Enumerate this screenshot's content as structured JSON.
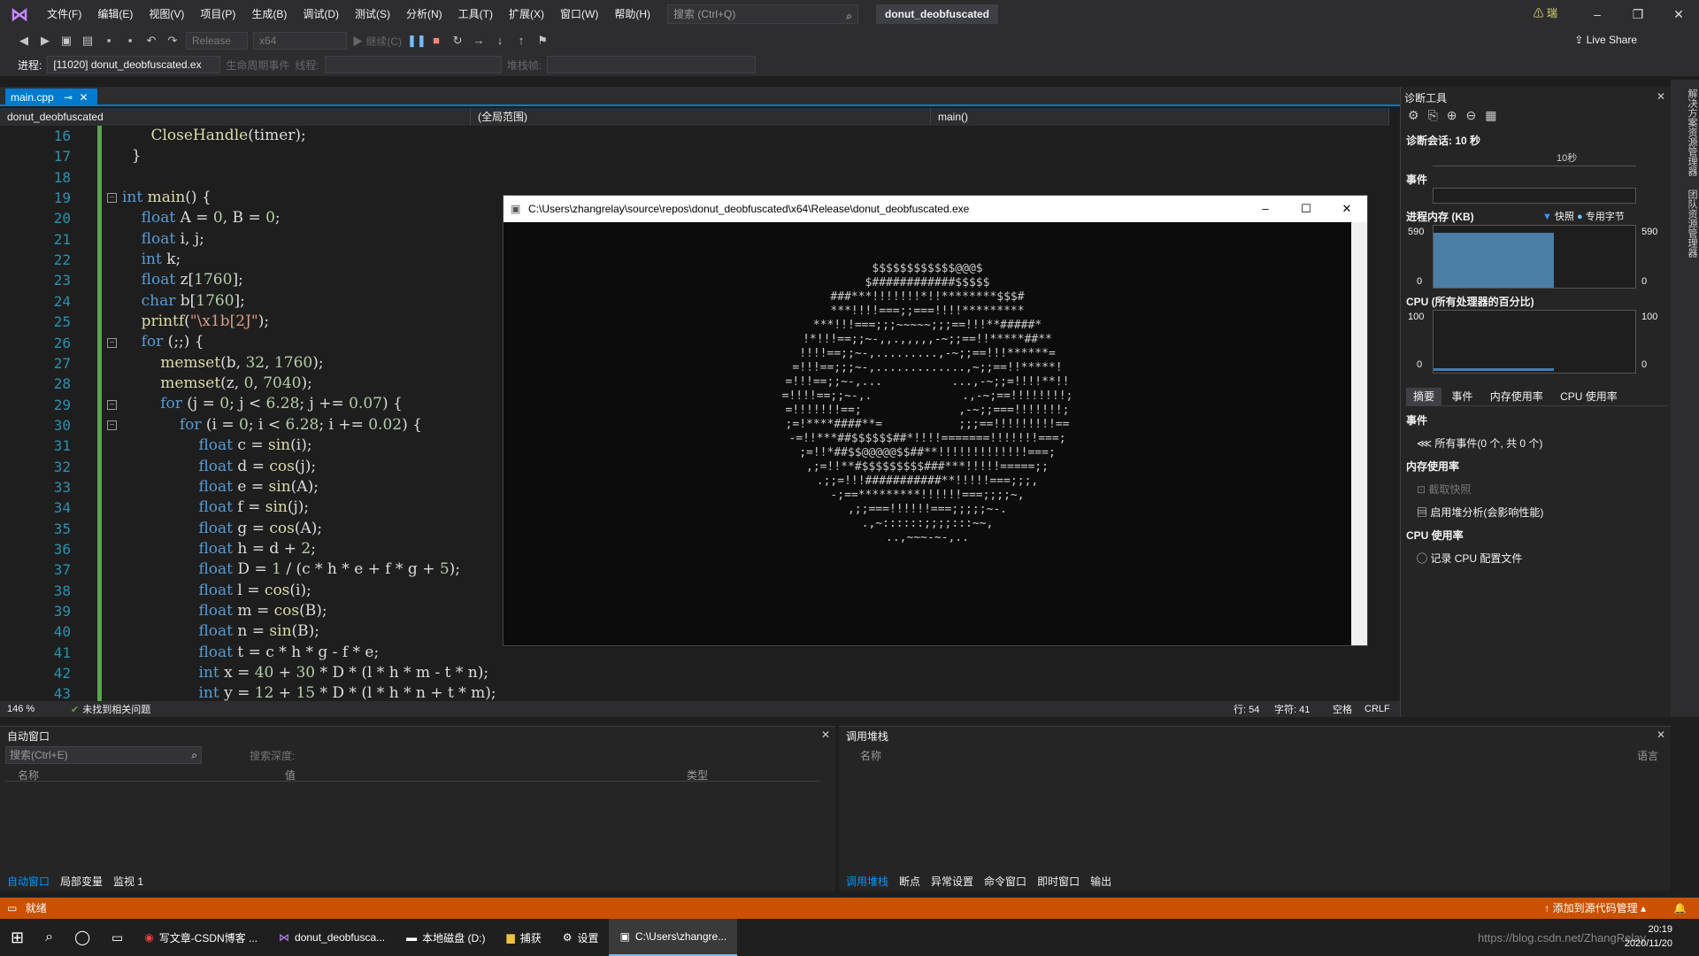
{
  "menubar": {
    "items": [
      "文件(F)",
      "编辑(E)",
      "视图(V)",
      "项目(P)",
      "生成(B)",
      "调试(D)",
      "测试(S)",
      "分析(N)",
      "工具(T)",
      "扩展(X)",
      "窗口(W)",
      "帮助(H)"
    ],
    "search_placeholder": "搜索 (Ctrl+Q)",
    "solution_name": "donut_deobfuscated",
    "user": "瑞"
  },
  "toolbar": {
    "config": "Release",
    "platform": "x64",
    "continue_label": "继续(C)",
    "live_share": "Live Share",
    "process_label": "进程:",
    "process_value": "[11020] donut_deobfuscated.ex",
    "lifecycle_label": "生命周期事件",
    "thread_label": "线程:",
    "stackframe_label": "堆栈帧:"
  },
  "editor": {
    "tab_label": "main.cpp",
    "nav_project": "donut_deobfuscated",
    "nav_scope": "(全局范围)",
    "nav_function": "main()",
    "line_numbers": [
      "16",
      "17",
      "18",
      "19",
      "20",
      "21",
      "22",
      "23",
      "24",
      "25",
      "26",
      "27",
      "28",
      "29",
      "30",
      "31",
      "32",
      "33",
      "34",
      "35",
      "36",
      "37",
      "38",
      "39",
      "40",
      "41",
      "42",
      "43"
    ],
    "zoom": "146 %",
    "issues": "未找到相关问题",
    "row": "行: 54",
    "col": "字符: 41",
    "whitespace": "空格",
    "eol": "CRLF"
  },
  "console": {
    "title": "C:\\Users\\zhangrelay\\source\\repos\\donut_deobfuscated\\x64\\Release\\donut_deobfuscated.exe"
  },
  "diagnostics": {
    "title": "诊断工具",
    "session": "诊断会话: 10 秒",
    "timeline_label": "10秒",
    "events_section": "事件",
    "memory_section": "进程内存 (KB)",
    "memory_legend_snapshot": "快照",
    "memory_legend_private": "专用字节",
    "memory_max": "590",
    "memory_min": "0",
    "cpu_section": "CPU (所有处理器的百分比)",
    "cpu_max": "100",
    "cpu_min": "0",
    "tabs": [
      "摘要",
      "事件",
      "内存使用率",
      "CPU 使用率"
    ],
    "summary_events": "事件",
    "all_events": "所有事件(0 个, 共 0 个)",
    "mem_usage": "内存使用率",
    "take_snapshot": "截取快照",
    "heap_analysis": "启用堆分析(会影响性能)",
    "cpu_usage": "CPU 使用率",
    "record_cpu": "记录 CPU 配置文件"
  },
  "autos": {
    "title": "自动窗口",
    "search_placeholder": "搜索(Ctrl+E)",
    "search_depth": "搜索深度:",
    "col_name": "名称",
    "col_value": "值",
    "col_type": "类型",
    "tabs": [
      "自动窗口",
      "局部变量",
      "监视 1"
    ]
  },
  "callstack": {
    "title": "调用堆栈",
    "col_name": "名称",
    "col_lang": "语言",
    "tabs": [
      "调用堆栈",
      "断点",
      "异常设置",
      "命令窗口",
      "即时窗口",
      "输出"
    ]
  },
  "statusbar": {
    "ready": "就绪",
    "source_control": "添加到源代码管理"
  },
  "taskbar": {
    "items": [
      "写文章-CSDN博客 ...",
      "donut_deobfusca...",
      "本地磁盘 (D:)",
      "捕获",
      "设置",
      "C:\\Users\\zhangre..."
    ],
    "time": "20:19",
    "date": "2020/11/20",
    "watermark": "https://blog.csdn.net/ZhangRelay"
  }
}
